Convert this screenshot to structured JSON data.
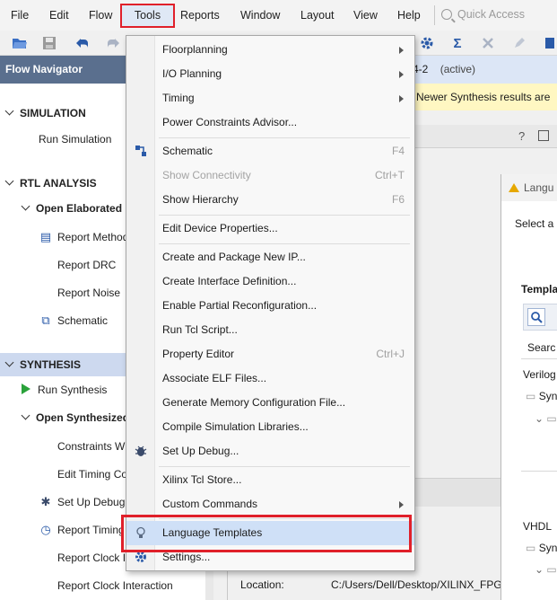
{
  "menubar": {
    "file": "File",
    "edit": "Edit",
    "flow": "Flow",
    "tools": "Tools",
    "reports": "Reports",
    "window": "Window",
    "layout": "Layout",
    "view": "View",
    "help": "Help",
    "quick_access_placeholder": "Quick Access"
  },
  "toolbar": {
    "icons": [
      "folder-open-icon",
      "save-icon",
      "undo-icon",
      "redo-icon",
      "gear-icon",
      "sigma-icon",
      "cross-icon",
      "pencil-icon",
      "chip-icon"
    ]
  },
  "flow_navigator": {
    "title": "Flow Navigator",
    "items": [
      {
        "label": "SIMULATION",
        "kind": "section"
      },
      {
        "label": "Run Simulation",
        "kind": "item"
      },
      {
        "label": "RTL ANALYSIS",
        "kind": "section"
      },
      {
        "label": "Open Elaborated",
        "kind": "subsection"
      },
      {
        "label": "Report Method",
        "kind": "item"
      },
      {
        "label": "Report DRC",
        "kind": "item"
      },
      {
        "label": "Report Noise",
        "kind": "item"
      },
      {
        "label": "Schematic",
        "kind": "item"
      },
      {
        "label": "SYNTHESIS",
        "kind": "section"
      },
      {
        "label": "Run Synthesis",
        "kind": "item"
      },
      {
        "label": "Open Synthesized",
        "kind": "subsection"
      },
      {
        "label": "Constraints W",
        "kind": "item"
      },
      {
        "label": "Edit Timing Co",
        "kind": "item"
      },
      {
        "label": "Set Up Debug",
        "kind": "item"
      },
      {
        "label": "Report Timing",
        "kind": "item"
      },
      {
        "label": "Report Clock I",
        "kind": "item"
      },
      {
        "label": "Report Clock Interaction",
        "kind": "item"
      }
    ]
  },
  "project": {
    "run_name": "4-2",
    "status": "(active)",
    "warning": "Newer Synthesis results are"
  },
  "properties": {
    "location_label": "Location:",
    "location_value": "C:/Users/Dell/Desktop/XILINX_FPG"
  },
  "language_templates_dialog": {
    "title": "Langu",
    "prompt": "Select a",
    "templates_label": "Templa",
    "search_label": "Searc",
    "verilog_label": "Verilog",
    "verilog_child": "Syn",
    "vhdl_label": "VHDL",
    "vhdl_child": "Syn"
  },
  "tools_menu": {
    "items": [
      {
        "label": "Floorplanning",
        "submenu": true
      },
      {
        "label": "I/O Planning",
        "submenu": true
      },
      {
        "label": "Timing",
        "submenu": true
      },
      {
        "label": "Power Constraints Advisor..."
      },
      {
        "label": "Schematic",
        "shortcut": "F4",
        "icon": "schematic-icon"
      },
      {
        "label": "Show Connectivity",
        "shortcut": "Ctrl+T",
        "disabled": true
      },
      {
        "label": "Show Hierarchy",
        "shortcut": "F6"
      },
      {
        "label": "Edit Device Properties..."
      },
      {
        "label": "Create and Package New IP..."
      },
      {
        "label": "Create Interface Definition..."
      },
      {
        "label": "Enable Partial Reconfiguration..."
      },
      {
        "label": "Run Tcl Script..."
      },
      {
        "label": "Property Editor",
        "shortcut": "Ctrl+J"
      },
      {
        "label": "Associate ELF Files..."
      },
      {
        "label": "Generate Memory Configuration File..."
      },
      {
        "label": "Compile Simulation Libraries..."
      },
      {
        "label": "Set Up Debug...",
        "icon": "bug-icon"
      },
      {
        "label": "Xilinx Tcl Store..."
      },
      {
        "label": "Custom Commands",
        "submenu": true
      },
      {
        "label": "Language Templates",
        "icon": "lightbulb-icon",
        "highlighted": true
      },
      {
        "label": "Settings...",
        "icon": "gear-icon"
      }
    ]
  },
  "colors": {
    "highlight_border": "#e0202a",
    "menu_hover": "#cfe0f7",
    "nav_header": "#5a6f8e",
    "selected_row": "#cdd9ef"
  }
}
